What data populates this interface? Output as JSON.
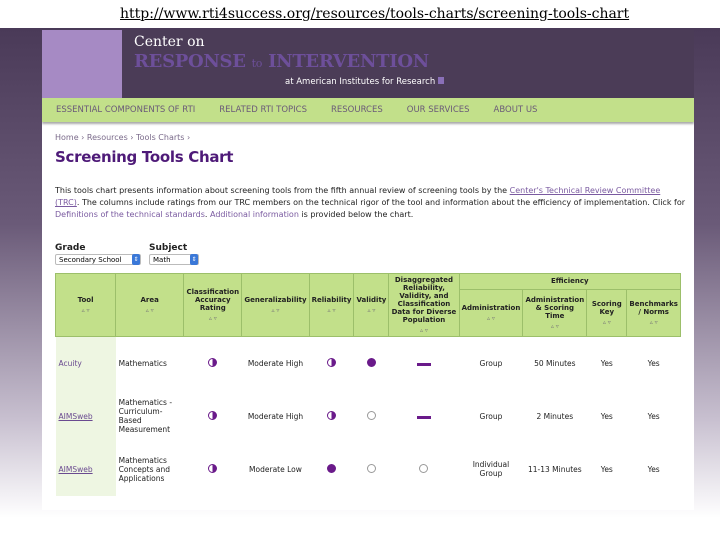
{
  "url": "http://www.rti4success.org/resources/tools-charts/screening-tools-chart",
  "header": {
    "line1": "Center on",
    "line2a": "RESPONSE",
    "line2b": "to",
    "line2c": "INTERVENTION",
    "line3": "at American Institutes for Research"
  },
  "nav": [
    "ESSENTIAL COMPONENTS OF RTI",
    "RELATED RTI TOPICS",
    "RESOURCES",
    "OUR SERVICES",
    "ABOUT US"
  ],
  "breadcrumb": "Home › Resources › Tools Charts ›",
  "title": "Screening Tools Chart",
  "intro": {
    "p1": "This tools chart presents information about screening tools from the fifth annual review of screening tools by the ",
    "link1": "Center's Technical Review Committee (TRC)",
    "p2": ". The columns include ratings from our TRC members on the technical rigor of the tool and information about the efficiency of implementation. Click for ",
    "link2": "Definitions of the technical standards",
    "p3": ". ",
    "link3": "Additional information",
    "p4": " is provided below the chart."
  },
  "filters": {
    "grade_label": "Grade",
    "grade_value": "Secondary School",
    "subject_label": "Subject",
    "subject_value": "Math"
  },
  "table": {
    "group_efficiency": "Efficiency",
    "sort": "▵ ▿",
    "headers": [
      "Tool",
      "Area",
      "Classification Accuracy Rating",
      "Generalizability",
      "Reliability",
      "Validity",
      "Disaggregated Reliability, Validity, and Classification Data for Diverse Population",
      "Administration",
      "Administration & Scoring Time",
      "Scoring Key",
      "Benchmarks / Norms"
    ],
    "rows": [
      {
        "tool": "Acuity",
        "area": "Mathematics",
        "classification": "half",
        "generalizability": "Moderate High",
        "reliability": "half",
        "validity": "full",
        "disaggregated": "dash",
        "administration": "Group",
        "time": "50 Minutes",
        "scoring_key": "Yes",
        "benchmarks": "Yes"
      },
      {
        "tool": "AIMSweb",
        "area": "Mathematics - Curriculum-Based Measurement",
        "classification": "half",
        "generalizability": "Moderate High",
        "reliability": "half",
        "validity": "empty",
        "disaggregated": "dash",
        "administration": "Group",
        "time": "2 Minutes",
        "scoring_key": "Yes",
        "benchmarks": "Yes"
      },
      {
        "tool": "AIMSweb",
        "area": "Mathematics Concepts and Applications",
        "classification": "half",
        "generalizability": "Moderate Low",
        "reliability": "full",
        "validity": "empty",
        "disaggregated": "empty",
        "administration": "Individual Group",
        "time": "11-13 Minutes",
        "scoring_key": "Yes",
        "benchmarks": "Yes"
      }
    ]
  }
}
